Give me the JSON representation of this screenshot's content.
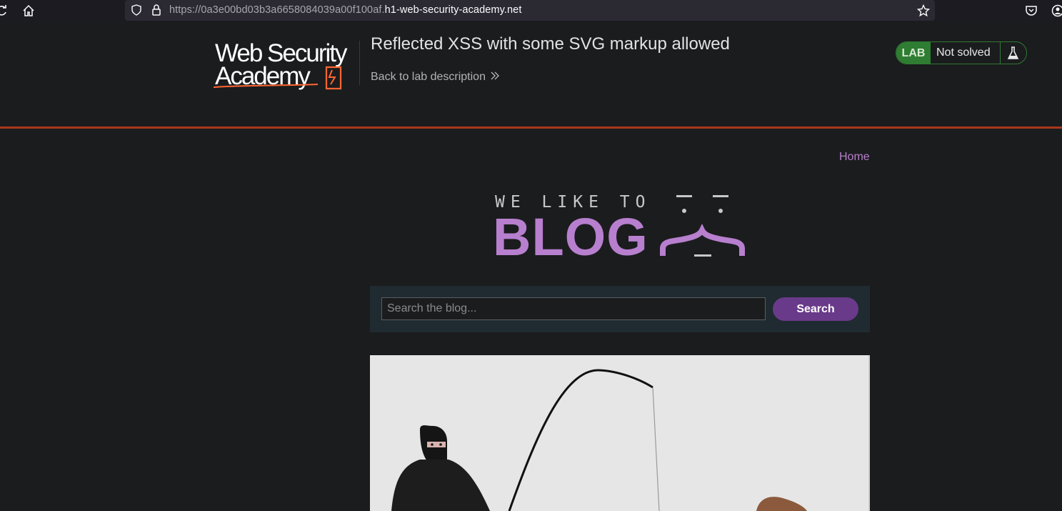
{
  "browser": {
    "url_dim": "https://0a3e00bd03b3a6658084039a00f100af.",
    "url_host": "h1-web-security-academy.net"
  },
  "lab": {
    "logo_text_1": "Web Security",
    "logo_text_2": "Academy",
    "title": "Reflected XSS with some SVG markup allowed",
    "back_link": "Back to lab description",
    "status_badge": "LAB",
    "status_text": "Not solved",
    "status_color": "#2e7d32",
    "accent_rule_color": "#a8361a"
  },
  "blog": {
    "nav_home": "Home",
    "banner_top": "WE LIKE TO",
    "banner_main": "BLOG",
    "banner_color": "#b77fce",
    "search_placeholder": "Search the blog...",
    "search_button": "Search"
  }
}
